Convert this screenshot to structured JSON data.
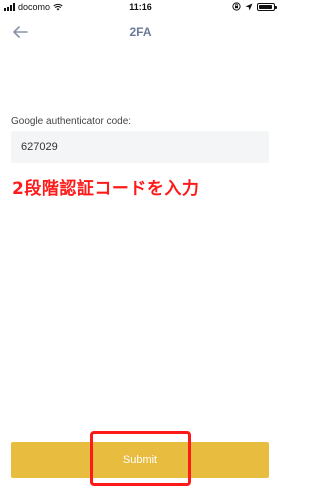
{
  "status_bar": {
    "carrier": "docomo",
    "time": "11:16",
    "battery_level": 0.9,
    "icons": [
      "signal-icon",
      "wifi-icon",
      "orientation-lock-icon",
      "location-icon",
      "battery-icon"
    ]
  },
  "nav": {
    "title": "2FA",
    "back_icon": "back-arrow-icon"
  },
  "form": {
    "label": "Google authenticator code:",
    "code_value": "627029",
    "annotation": "2段階認証コードを入力"
  },
  "submit": {
    "label": "Submit"
  },
  "colors": {
    "accent": "#e8bc3e",
    "annotation": "#ff1a1a",
    "title": "#6b7a99",
    "input_bg": "#f4f5f7"
  }
}
